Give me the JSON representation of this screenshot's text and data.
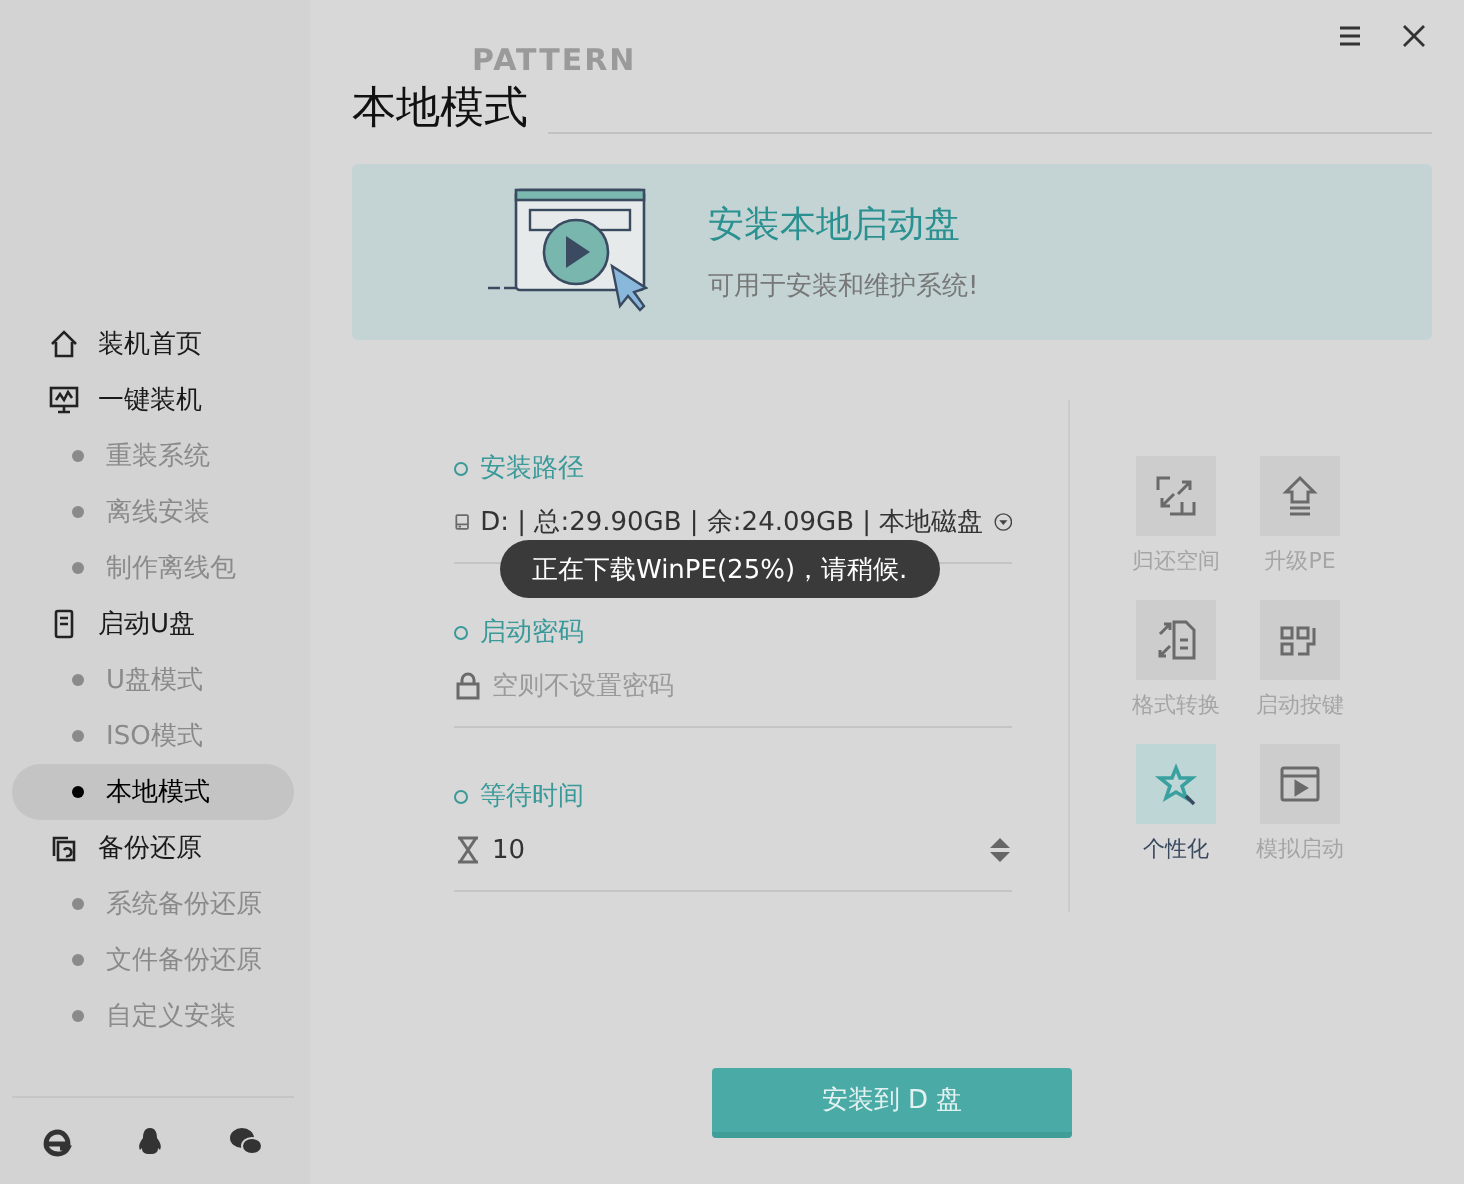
{
  "window": {
    "controls": [
      {
        "kind": "menu"
      },
      {
        "kind": "close"
      }
    ]
  },
  "sidebar": {
    "items": [
      {
        "label": "装机首页",
        "selected": false
      },
      {
        "label": "一键装机",
        "selected": false,
        "children": [
          {
            "label": "重装系统",
            "selected": false
          },
          {
            "label": "离线安装",
            "selected": false
          },
          {
            "label": "制作离线包",
            "selected": false
          }
        ]
      },
      {
        "label": "启动U盘",
        "selected": false,
        "children": [
          {
            "label": "U盘模式",
            "selected": false
          },
          {
            "label": "ISO模式",
            "selected": false
          },
          {
            "label": "本地模式",
            "selected": true
          }
        ]
      },
      {
        "label": "备份还原",
        "selected": false,
        "children": [
          {
            "label": "系统备份还原",
            "selected": false
          },
          {
            "label": "文件备份还原",
            "selected": false
          },
          {
            "label": "自定义安装",
            "selected": false
          }
        ]
      }
    ],
    "footer_icons": [
      {
        "kind": "ie"
      },
      {
        "kind": "penguin"
      },
      {
        "kind": "chat"
      }
    ]
  },
  "page": {
    "background_word": "PATTERN",
    "title": "本地模式"
  },
  "banner": {
    "title": "安装本地启动盘",
    "subtitle": "可用于安装和维护系统!"
  },
  "form": {
    "fields": [
      {
        "label": "安装路径",
        "kind": "select",
        "value": "D: | 总:29.90GB | 余:24.09GB | 本地磁盘"
      },
      {
        "label": "启动密码",
        "kind": "password",
        "placeholder": "空则不设置密码"
      },
      {
        "label": "等待时间",
        "kind": "spinner",
        "value": "10"
      }
    ]
  },
  "tools": [
    {
      "label": "归还空间",
      "selected": false
    },
    {
      "label": "升级PE",
      "selected": false
    },
    {
      "label": "格式转换",
      "selected": false
    },
    {
      "label": "启动按键",
      "selected": false
    },
    {
      "label": "个性化",
      "selected": true
    },
    {
      "label": "模拟启动",
      "selected": false
    }
  ],
  "install_button": "安装到 D 盘",
  "toast": "正在下载WinPE(25%)，请稍候."
}
